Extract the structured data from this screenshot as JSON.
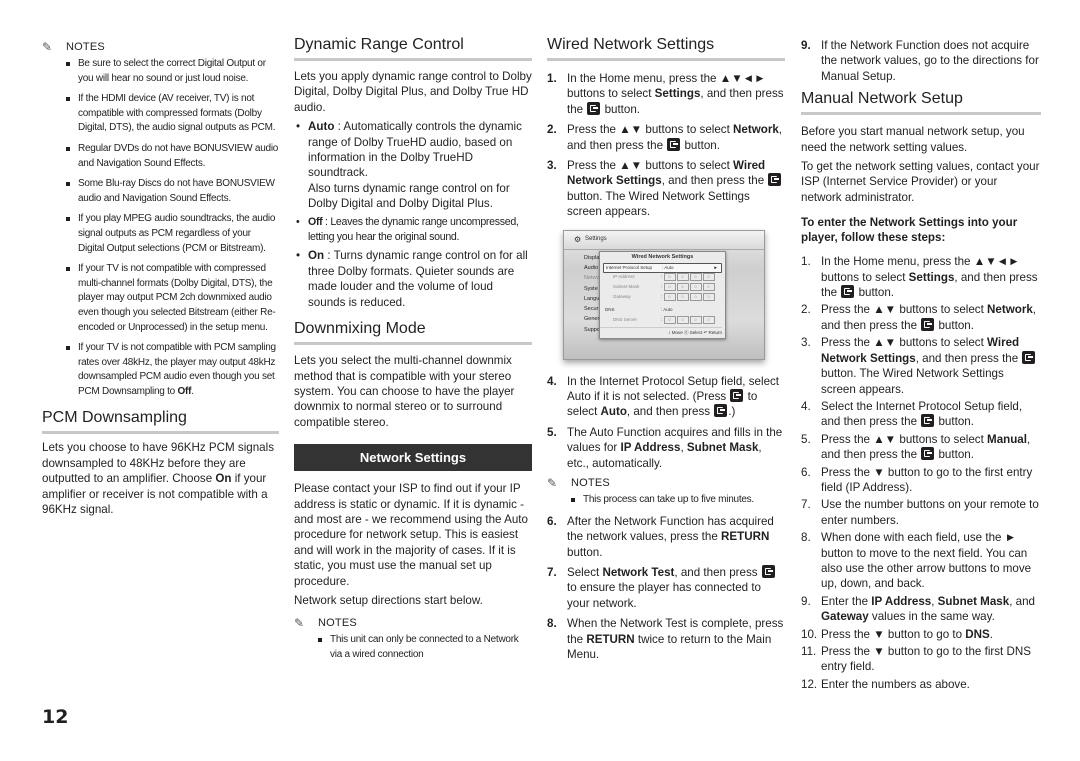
{
  "page_number": "12",
  "arrows": {
    "udlr": "▲▼◄►",
    "ud": "▲▼",
    "down": "▼",
    "right": "►"
  },
  "col1": {
    "notes_label": "NOTES",
    "notes": [
      "Be sure to select the correct Digital Output or you will hear no sound or just loud noise.",
      "If the HDMI device (AV receiver, TV) is not compatible with compressed formats (Dolby Digital, DTS), the audio signal outputs as PCM.",
      "Regular DVDs do not have BONUSVIEW audio and Navigation Sound Effects.",
      "Some Blu-ray Discs do not have BONUSVIEW audio and Navigation Sound Effects.",
      "If you play MPEG audio soundtracks, the audio signal outputs as PCM regardless of your Digital Output selections (PCM or Bitstream).",
      "If your TV is not compatible with compressed multi-channel formats (Dolby Digital, DTS), the player may output PCM 2ch downmixed audio even though you selected Bitstream (either Re-encoded or Unprocessed) in the setup menu."
    ],
    "last_note_pre": "If your TV is not compatible with PCM sampling rates over 48kHz, the player may output 48kHz downsampled PCM audio even though you set PCM Downsampling to ",
    "last_note_bold": "Off",
    "last_note_post": ".",
    "pcm": {
      "title": "PCM Downsampling",
      "body_pre": "Lets you choose to have 96KHz PCM signals downsampled to 48KHz before they are outputted to an amplifier. Choose ",
      "body_bold": "On",
      "body_post": " if your amplifier or receiver is not compatible with a 96KHz signal."
    }
  },
  "col2": {
    "drc": {
      "title": "Dynamic Range Control",
      "intro": "Lets you apply dynamic range control to Dolby Digital, Dolby Digital Plus, and Dolby True HD audio.",
      "auto_label": "Auto",
      "auto_text": " : Automatically controls the dynamic range of Dolby TrueHD audio, based on information in the Dolby TrueHD soundtrack.",
      "auto_text2": "Also turns dynamic range control on for Dolby Digital and Dolby Digital Plus.",
      "off_label": "Off",
      "off_text": " : Leaves the dynamic range uncompressed, letting you hear the original sound.",
      "on_label": "On",
      "on_text": " : Turns dynamic range control on for all three Dolby formats. Quieter sounds are made louder and the volume of loud sounds is reduced."
    },
    "downmix": {
      "title": "Downmixing Mode",
      "body": "Lets you select the multi-channel downmix method that is compatible with your stereo system. You can choose to have the player downmix to normal stereo or to surround compatible stereo."
    },
    "network": {
      "bar_title": "Network Settings",
      "body": "Please contact your ISP to find out if your IP address is static or dynamic. If it is dynamic - and most are - we recommend using the Auto procedure for network setup. This is easiest and will work in the majority of cases. If it is static, you must use the manual set up procedure.",
      "body2": "Network setup directions start below.",
      "notes_label": "NOTES",
      "notes": [
        "This unit can only be connected to a Network via a wired connection"
      ]
    }
  },
  "col3": {
    "title": "Wired Network Settings",
    "s1_pre": "In the Home menu, press the ",
    "s1_mid": " buttons to select ",
    "s1_bold": "Settings",
    "s1_post": ", and then press the ",
    "s1_end": " button.",
    "s2_pre": "Press the ",
    "s2_mid": " buttons to select ",
    "s2_bold": "Network",
    "s2_post": ", and then press the ",
    "s2_end": " button.",
    "s3_pre": "Press the ",
    "s3_mid": " buttons to select ",
    "s3_bold": "Wired Network Settings",
    "s3_post": ", and then press the ",
    "s3_end": " button. The Wired Network Settings screen appears.",
    "tv": {
      "header": "Settings",
      "menu": [
        "Displa",
        "Audio",
        "Netwo",
        "Syste",
        "Langu",
        "Secur",
        "Gener",
        "Suppo"
      ],
      "dialog_title": "Wired Network Settings",
      "rows": [
        {
          "label": "Internet Protocol Setup",
          "value": ": Auto"
        },
        {
          "label": "IP Address",
          "value": ":"
        },
        {
          "label": "Subnet Mask",
          "value": ":"
        },
        {
          "label": "Gateway",
          "value": ":"
        },
        {
          "label": "DNS",
          "value": ": Auto"
        },
        {
          "label": "DNS Server",
          "value": ":"
        }
      ],
      "octet": "0",
      "footer": "↕ Move  ⓔ Select  ↶ Return"
    },
    "s4_pre": "In the Internet Protocol Setup field, select Auto if it is not selected. (Press ",
    "s4_mid": " to select ",
    "s4_bold": "Auto",
    "s4_post": ", and then press ",
    "s4_end": ".)",
    "s5_pre": "The Auto Function acquires and fills in the values for ",
    "s5_b1": "IP Address",
    "s5_sep": ", ",
    "s5_b2": "Subnet Mask",
    "s5_post": ", etc., automatically.",
    "notes_label": "NOTES",
    "notes": [
      "This process can take up to five minutes."
    ],
    "s6_pre": "After the Network Function has acquired the network values, press the ",
    "s6_bold": "RETURN",
    "s6_post": " button.",
    "s7_pre": "Select ",
    "s7_bold": "Network Test",
    "s7_post": ", and then press ",
    "s7_end": " to ensure the player has connected to your network.",
    "s8_pre": "When the Network Test is complete, press the ",
    "s8_bold": "RETURN",
    "s8_post": " twice to return to the Main Menu."
  },
  "col4": {
    "s9": "If the Network Function does not acquire the network values, go to the directions for Manual Setup.",
    "title": "Manual Network Setup",
    "p1": "Before you start manual network setup, you need the network setting values.",
    "p2": "To get the network setting values, contact your ISP (Internet Service Provider) or your network administrator.",
    "subhead": "To enter the Network Settings into your player, follow these steps:",
    "m4_pre": "Select the Internet Protocol Setup field, and then press the ",
    "m4_end": " button.",
    "m5_bold": "Manual",
    "m6_pre": "Press the ",
    "m6_post": " button to go to the first entry field (IP Address).",
    "m7": "Use the number buttons on your remote to enter numbers.",
    "m8_pre": "When done with each field, use the ",
    "m8_post": " button to move to the next field. You can also use the other arrow buttons to move up, down, and back.",
    "m9_pre": "Enter the ",
    "m9_b1": "IP Address",
    "m9_b2": "Subnet Mask",
    "m9_mid": ", and ",
    "m9_b3": "Gateway",
    "m9_post": " values in the same way.",
    "m10_pre": "Press the ",
    "m10_mid": " button to go to ",
    "m10_bold": "DNS",
    "m10_post": ".",
    "m11_pre": "Press the ",
    "m11_post": " button to go to the first DNS entry field.",
    "m12": "Enter the numbers as above."
  },
  "num": {
    "n1": "1.",
    "n2": "2.",
    "n3": "3.",
    "n4": "4.",
    "n5": "5.",
    "n6": "6.",
    "n7": "7.",
    "n8": "8.",
    "n9": "9.",
    "n10": "10.",
    "n11": "11.",
    "n12": "12."
  },
  "comma": ", "
}
